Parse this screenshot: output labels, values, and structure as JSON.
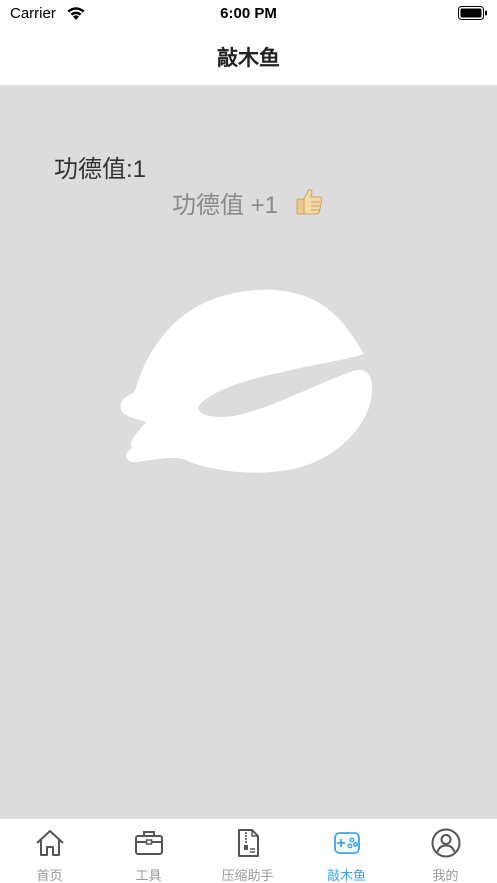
{
  "status_bar": {
    "carrier": "Carrier",
    "time": "6:00 PM",
    "icons": [
      "wifi-icon",
      "battery-icon"
    ]
  },
  "nav": {
    "title": "敲木鱼"
  },
  "main": {
    "merit_total": "功德值:1",
    "merit_float": "功德值 +1",
    "merit_float_icon": "thumbs-up-icon",
    "fish_icon": "wooden-fish-icon",
    "background_color": "#dcdcdc"
  },
  "tab_bar": {
    "active_color": "#3aa6f0",
    "inactive_color": "#9a9a9a",
    "tabs": [
      {
        "label": "首页",
        "icon": "home-icon",
        "active": false
      },
      {
        "label": "工具",
        "icon": "toolbox-icon",
        "active": false
      },
      {
        "label": "压缩助手",
        "icon": "zip-file-icon",
        "active": false
      },
      {
        "label": "敲木鱼",
        "icon": "gamepad-icon",
        "active": true
      },
      {
        "label": "我的",
        "icon": "user-icon",
        "active": false
      }
    ]
  }
}
